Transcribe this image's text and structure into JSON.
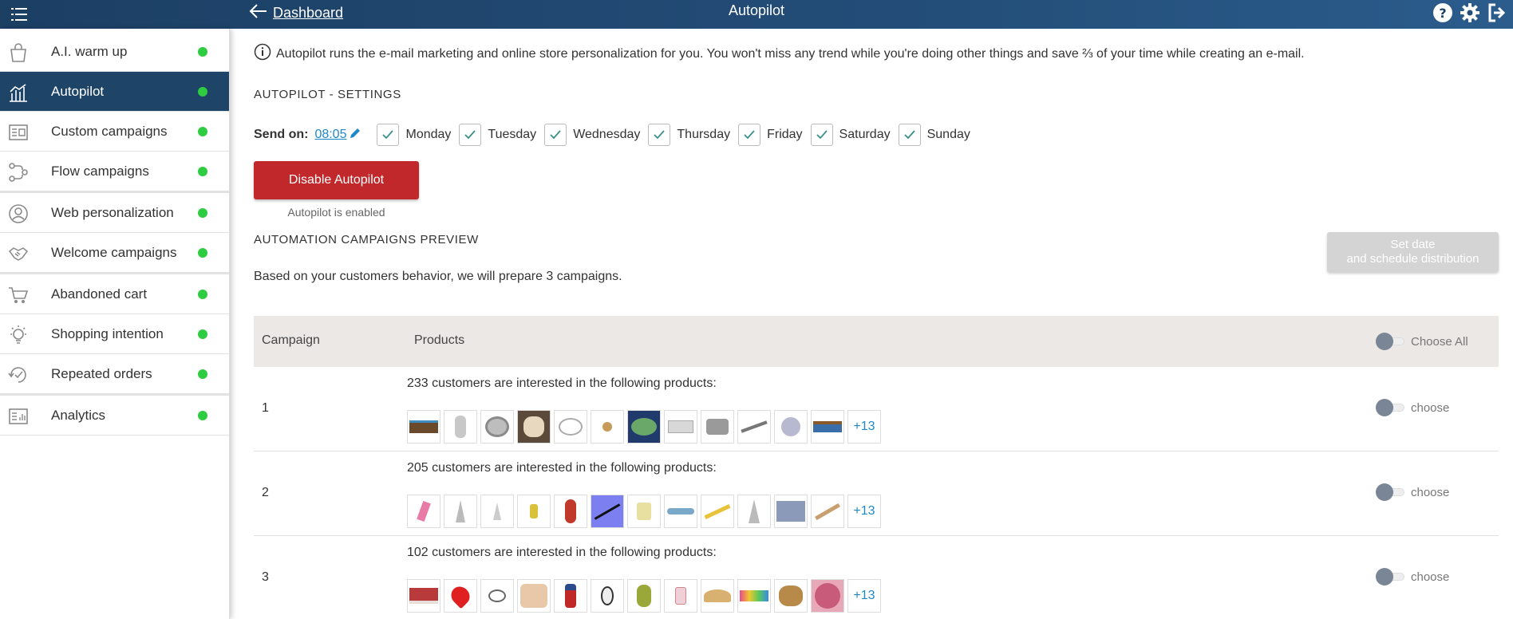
{
  "topbar": {
    "back_label": "Dashboard",
    "title": "Autopilot"
  },
  "sidebar": {
    "items": [
      {
        "label": "A.I. warm up",
        "icon": "bag-icon"
      },
      {
        "label": "Autopilot",
        "icon": "chart-icon"
      },
      {
        "label": "Custom campaigns",
        "icon": "campaign-card-icon"
      },
      {
        "label": "Flow campaigns",
        "icon": "flow-icon"
      },
      {
        "label": "Web personalization",
        "icon": "user-circle-icon"
      },
      {
        "label": "Welcome campaigns",
        "icon": "handshake-icon"
      },
      {
        "label": "Abandoned cart",
        "icon": "cart-icon"
      },
      {
        "label": "Shopping intention",
        "icon": "lightbulb-icon"
      },
      {
        "label": "Repeated orders",
        "icon": "repeat-icon"
      },
      {
        "label": "Analytics",
        "icon": "analytics-card-icon"
      }
    ]
  },
  "main": {
    "info": "Autopilot runs the e-mail marketing and online store personalization for you. You won't miss any trend while you're doing other things and save ⅔ of your time while creating an e-mail.",
    "settings_title": "AUTOPILOT - SETTINGS",
    "send_on_label": "Send on:",
    "send_time": "08:05",
    "days": [
      "Monday",
      "Tuesday",
      "Wednesday",
      "Thursday",
      "Friday",
      "Saturday",
      "Sunday"
    ],
    "disable_button": "Disable Autopilot",
    "enabled_note": "Autopilot is enabled",
    "preview_title": "AUTOMATION CAMPAIGNS PREVIEW",
    "schedule_button_line1": "Set date",
    "schedule_button_line2": "and schedule distribution",
    "based_text": "Based on your customers behavior, we will prepare 3 campaigns.",
    "table": {
      "col_campaign": "Campaign",
      "col_products": "Products",
      "choose_all": "Choose All",
      "rows": [
        {
          "num": "1",
          "desc": "233 customers are interested in the following products:",
          "more": "+13",
          "choose": "choose"
        },
        {
          "num": "2",
          "desc": "205 customers are interested in the following products:",
          "more": "+13",
          "choose": "choose"
        },
        {
          "num": "3",
          "desc": "102 customers are interested in the following products:",
          "more": "+13",
          "choose": "choose"
        }
      ]
    }
  },
  "colors": {
    "topbar": "#1c3f64",
    "active_nav": "#1e4468",
    "status_dot": "#2ecc40",
    "disable_button": "#c0282b",
    "link": "#1f88c9"
  }
}
